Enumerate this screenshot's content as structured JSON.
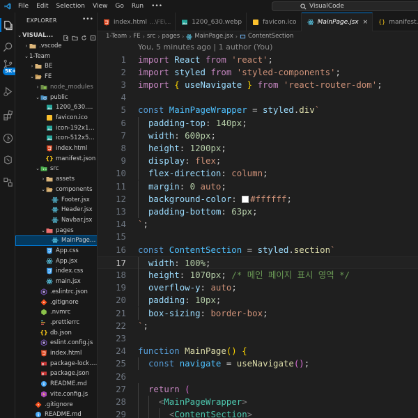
{
  "menubar": {
    "items": [
      "File",
      "Edit",
      "Selection",
      "View",
      "Go",
      "Run",
      "•••"
    ],
    "search_text": "VisualCode"
  },
  "activitybar": {
    "badge": "5K+",
    "items": [
      "files-icon",
      "search-icon",
      "source-control-icon",
      "run-debug-icon",
      "extensions-icon",
      "github-icon",
      "remote-icon",
      "testing-icon"
    ]
  },
  "sidebar": {
    "title": "EXPLORER",
    "more": "•••",
    "root_label": "VISUAL...",
    "items": [
      {
        "label": "VISUAL...",
        "depth": 0,
        "chev": "⌄",
        "icon": "",
        "kind": "root"
      },
      {
        "label": ".vscode",
        "depth": 1,
        "chev": "›",
        "icon": "folder-icon",
        "kind": "folder"
      },
      {
        "label": "1-Team",
        "depth": 1,
        "chev": "⌄",
        "icon": "",
        "kind": "folder-plain"
      },
      {
        "label": "BE",
        "depth": 2,
        "chev": "›",
        "icon": "folder-icon",
        "kind": "folder"
      },
      {
        "label": "FE",
        "depth": 2,
        "chev": "⌄",
        "icon": "folder-open-icon",
        "kind": "folder"
      },
      {
        "label": "node_modules",
        "depth": 3,
        "chev": "›",
        "icon": "node-folder-icon",
        "kind": "dim"
      },
      {
        "label": "public",
        "depth": 3,
        "chev": "⌄",
        "icon": "public-folder-icon",
        "kind": "folder"
      },
      {
        "label": "1200_630.webp",
        "depth": 4,
        "chev": "",
        "icon": "image-file-icon",
        "kind": "file"
      },
      {
        "label": "favicon.ico",
        "depth": 4,
        "chev": "",
        "icon": "favicon-file-icon",
        "kind": "file"
      },
      {
        "label": "icon-192x192...",
        "depth": 4,
        "chev": "",
        "icon": "image-file-icon",
        "kind": "file"
      },
      {
        "label": "icon-512x512...",
        "depth": 4,
        "chev": "",
        "icon": "image-file-icon",
        "kind": "file"
      },
      {
        "label": "index.html",
        "depth": 4,
        "chev": "",
        "icon": "html-file-icon",
        "kind": "file"
      },
      {
        "label": "manifest.json",
        "depth": 4,
        "chev": "",
        "icon": "json-file-icon",
        "kind": "file"
      },
      {
        "label": "src",
        "depth": 3,
        "chev": "⌄",
        "icon": "src-folder-icon",
        "kind": "folder"
      },
      {
        "label": "assets",
        "depth": 4,
        "chev": "›",
        "icon": "folder-icon",
        "kind": "folder"
      },
      {
        "label": "components",
        "depth": 4,
        "chev": "⌄",
        "icon": "folder-open-icon",
        "kind": "folder"
      },
      {
        "label": "Footer.jsx",
        "depth": 5,
        "chev": "",
        "icon": "react-file-icon",
        "kind": "file"
      },
      {
        "label": "Header.jsx",
        "depth": 5,
        "chev": "",
        "icon": "react-file-icon",
        "kind": "file"
      },
      {
        "label": "Navbar.jsx",
        "depth": 5,
        "chev": "",
        "icon": "react-file-icon",
        "kind": "file"
      },
      {
        "label": "pages",
        "depth": 4,
        "chev": "⌄",
        "icon": "pages-folder-icon",
        "kind": "folder"
      },
      {
        "label": "MainPage.jsx",
        "depth": 5,
        "chev": "",
        "icon": "react-file-icon",
        "kind": "selected"
      },
      {
        "label": "App.css",
        "depth": 4,
        "chev": "",
        "icon": "css-file-icon",
        "kind": "file"
      },
      {
        "label": "App.jsx",
        "depth": 4,
        "chev": "",
        "icon": "react-file-icon",
        "kind": "file"
      },
      {
        "label": "index.css",
        "depth": 4,
        "chev": "",
        "icon": "css-file-icon",
        "kind": "file"
      },
      {
        "label": "main.jsx",
        "depth": 4,
        "chev": "",
        "icon": "react-file-icon",
        "kind": "file"
      },
      {
        "label": ".eslintrc.json",
        "depth": 3,
        "chev": "",
        "icon": "eslint-file-icon",
        "kind": "file"
      },
      {
        "label": ".gitignore",
        "depth": 3,
        "chev": "",
        "icon": "git-file-icon",
        "kind": "file"
      },
      {
        "label": ".nvmrc",
        "depth": 3,
        "chev": "",
        "icon": "node-file-icon",
        "kind": "file"
      },
      {
        "label": ".prettierrc",
        "depth": 3,
        "chev": "",
        "icon": "prettier-file-icon",
        "kind": "file"
      },
      {
        "label": "db.json",
        "depth": 3,
        "chev": "",
        "icon": "json-file-icon",
        "kind": "file"
      },
      {
        "label": "eslint.config.js",
        "depth": 3,
        "chev": "",
        "icon": "eslint-file-icon",
        "kind": "file"
      },
      {
        "label": "index.html",
        "depth": 3,
        "chev": "",
        "icon": "html-file-icon",
        "kind": "file"
      },
      {
        "label": "package-lock.j...",
        "depth": 3,
        "chev": "",
        "icon": "npm-file-icon",
        "kind": "file"
      },
      {
        "label": "package.json",
        "depth": 3,
        "chev": "",
        "icon": "npm-file-icon",
        "kind": "file"
      },
      {
        "label": "README.md",
        "depth": 3,
        "chev": "",
        "icon": "info-file-icon",
        "kind": "file"
      },
      {
        "label": "vite.config.js",
        "depth": 3,
        "chev": "",
        "icon": "js-file-icon",
        "kind": "file"
      },
      {
        "label": ".gitignore",
        "depth": 2,
        "chev": "",
        "icon": "git-file-icon",
        "kind": "file"
      },
      {
        "label": "README.md",
        "depth": 2,
        "chev": "",
        "icon": "info-file-icon",
        "kind": "file"
      }
    ]
  },
  "tabs": [
    {
      "label": "index.html",
      "desc": "...\\FE\\...",
      "icon": "html-file-icon",
      "active": false
    },
    {
      "label": "1200_630.webp",
      "desc": "",
      "icon": "image-file-icon",
      "active": false
    },
    {
      "label": "favicon.ico",
      "desc": "",
      "icon": "favicon-file-icon",
      "active": false
    },
    {
      "label": "MainPage.jsx",
      "desc": "",
      "icon": "react-file-icon",
      "active": true,
      "close": "×"
    },
    {
      "label": "manifest.json",
      "desc": "",
      "icon": "json-file-icon",
      "active": false
    }
  ],
  "breadcrumb": [
    "1-Team",
    "FE",
    "src",
    "pages",
    "MainPage.jsx",
    "ContentSection"
  ],
  "editor": {
    "blame": "You, 5 minutes ago | 1 author (You)",
    "current_line": 17,
    "lines": [
      {
        "n": "1",
        "indent": 0,
        "t": [
          [
            "kw",
            "import "
          ],
          [
            "id",
            "React "
          ],
          [
            "kw",
            "from "
          ],
          [
            "str",
            "'react'"
          ],
          [
            "pun",
            ";"
          ]
        ]
      },
      {
        "n": "2",
        "indent": 0,
        "t": [
          [
            "kw",
            "import "
          ],
          [
            "id",
            "styled "
          ],
          [
            "kw",
            "from "
          ],
          [
            "str",
            "'styled-components'"
          ],
          [
            "pun",
            ";"
          ]
        ]
      },
      {
        "n": "3",
        "indent": 0,
        "t": [
          [
            "kw",
            "import "
          ],
          [
            "brk",
            "{ "
          ],
          [
            "id",
            "useNavigate "
          ],
          [
            "brk",
            "} "
          ],
          [
            "kw",
            "from "
          ],
          [
            "str",
            "'react-router-dom'"
          ],
          [
            "pun",
            ";"
          ]
        ]
      },
      {
        "n": "4",
        "indent": 0,
        "t": []
      },
      {
        "n": "5",
        "indent": 0,
        "t": [
          [
            "kw2",
            "const "
          ],
          [
            "cls",
            "MainPageWrapper "
          ],
          [
            "pun",
            "= "
          ],
          [
            "id",
            "styled"
          ],
          [
            "pun",
            "."
          ],
          [
            "fn",
            "div"
          ],
          [
            "str",
            "`"
          ]
        ]
      },
      {
        "n": "6",
        "indent": 1,
        "t": [
          [
            "prop",
            "padding-top"
          ],
          [
            "pun",
            ": "
          ],
          [
            "num",
            "140px"
          ],
          [
            "pun",
            ";"
          ]
        ]
      },
      {
        "n": "7",
        "indent": 1,
        "t": [
          [
            "prop",
            "width"
          ],
          [
            "pun",
            ": "
          ],
          [
            "num",
            "600px"
          ],
          [
            "pun",
            ";"
          ]
        ]
      },
      {
        "n": "8",
        "indent": 1,
        "t": [
          [
            "prop",
            "height"
          ],
          [
            "pun",
            ": "
          ],
          [
            "num",
            "1200px"
          ],
          [
            "pun",
            ";"
          ]
        ]
      },
      {
        "n": "9",
        "indent": 1,
        "t": [
          [
            "prop",
            "display"
          ],
          [
            "pun",
            ": "
          ],
          [
            "val",
            "flex"
          ],
          [
            "pun",
            ";"
          ]
        ]
      },
      {
        "n": "10",
        "indent": 1,
        "t": [
          [
            "prop",
            "flex-direction"
          ],
          [
            "pun",
            ": "
          ],
          [
            "val",
            "column"
          ],
          [
            "pun",
            ";"
          ]
        ]
      },
      {
        "n": "11",
        "indent": 1,
        "t": [
          [
            "prop",
            "margin"
          ],
          [
            "pun",
            ": "
          ],
          [
            "num",
            "0 "
          ],
          [
            "val",
            "auto"
          ],
          [
            "pun",
            ";"
          ]
        ]
      },
      {
        "n": "12",
        "indent": 1,
        "t": [
          [
            "prop",
            "background-color"
          ],
          [
            "pun",
            ": "
          ],
          [
            "swatch",
            "#ffffff"
          ],
          [
            "val",
            "#ffffff"
          ],
          [
            "pun",
            ";"
          ]
        ]
      },
      {
        "n": "13",
        "indent": 1,
        "t": [
          [
            "prop",
            "padding-bottom"
          ],
          [
            "pun",
            ": "
          ],
          [
            "num",
            "63px"
          ],
          [
            "pun",
            ";"
          ]
        ]
      },
      {
        "n": "14",
        "indent": 0,
        "t": [
          [
            "str",
            "`"
          ],
          [
            "pun",
            ";"
          ]
        ]
      },
      {
        "n": "15",
        "indent": 0,
        "t": []
      },
      {
        "n": "16",
        "indent": 0,
        "t": [
          [
            "kw2",
            "const "
          ],
          [
            "cls",
            "ContentSection "
          ],
          [
            "pun",
            "= "
          ],
          [
            "id",
            "styled"
          ],
          [
            "pun",
            "."
          ],
          [
            "fn",
            "section"
          ],
          [
            "str",
            "`"
          ]
        ]
      },
      {
        "n": "17",
        "indent": 1,
        "t": [
          [
            "prop",
            "width"
          ],
          [
            "pun",
            ": "
          ],
          [
            "num",
            "100%"
          ],
          [
            "pun",
            ";"
          ]
        ]
      },
      {
        "n": "18",
        "indent": 1,
        "t": [
          [
            "prop",
            "height"
          ],
          [
            "pun",
            ": "
          ],
          [
            "num",
            "1070px"
          ],
          [
            "pun",
            "; "
          ],
          [
            "cmt",
            "/* 메인 페이지 표시 영역 */"
          ]
        ]
      },
      {
        "n": "19",
        "indent": 1,
        "t": [
          [
            "prop",
            "overflow-y"
          ],
          [
            "pun",
            ": "
          ],
          [
            "val",
            "auto"
          ],
          [
            "pun",
            ";"
          ]
        ]
      },
      {
        "n": "20",
        "indent": 1,
        "t": [
          [
            "prop",
            "padding"
          ],
          [
            "pun",
            ": "
          ],
          [
            "num",
            "10px"
          ],
          [
            "pun",
            ";"
          ]
        ]
      },
      {
        "n": "21",
        "indent": 1,
        "t": [
          [
            "prop",
            "box-sizing"
          ],
          [
            "pun",
            ": "
          ],
          [
            "val",
            "border-box"
          ],
          [
            "pun",
            ";"
          ]
        ]
      },
      {
        "n": "22",
        "indent": 0,
        "t": [
          [
            "str",
            "`"
          ],
          [
            "pun",
            ";"
          ]
        ]
      },
      {
        "n": "23",
        "indent": 0,
        "t": []
      },
      {
        "n": "24",
        "indent": 0,
        "t": [
          [
            "kw2",
            "function "
          ],
          [
            "fn",
            "MainPage"
          ],
          [
            "brk",
            "() "
          ],
          [
            "brk",
            "{"
          ]
        ]
      },
      {
        "n": "25",
        "indent": 1,
        "t": [
          [
            "kw2",
            "const "
          ],
          [
            "cls",
            "navigate "
          ],
          [
            "pun",
            "= "
          ],
          [
            "fn",
            "useNavigate"
          ],
          [
            "brk2",
            "()"
          ],
          [
            "pun",
            ";"
          ]
        ]
      },
      {
        "n": "26",
        "indent": 0,
        "t": []
      },
      {
        "n": "27",
        "indent": 1,
        "t": [
          [
            "kw",
            "return "
          ],
          [
            "brk2",
            "("
          ]
        ]
      },
      {
        "n": "28",
        "indent": 2,
        "t": [
          [
            "tagp",
            "<"
          ],
          [
            "tag",
            "MainPageWrapper"
          ],
          [
            "tagp",
            ">"
          ]
        ]
      },
      {
        "n": "29",
        "indent": 3,
        "t": [
          [
            "tagp",
            "<"
          ],
          [
            "tag",
            "ContentSection"
          ],
          [
            "tagp",
            ">"
          ]
        ]
      }
    ]
  }
}
